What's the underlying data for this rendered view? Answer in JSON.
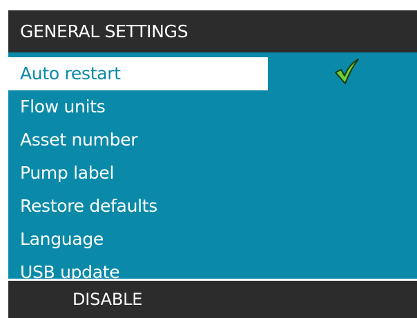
{
  "header": {
    "title": "GENERAL SETTINGS"
  },
  "menu": {
    "items": [
      {
        "label": "Auto restart",
        "selected": true,
        "checked": true
      },
      {
        "label": "Flow units"
      },
      {
        "label": "Asset number"
      },
      {
        "label": "Pump label"
      },
      {
        "label": "Restore defaults"
      },
      {
        "label": "Language"
      },
      {
        "label": "USB update"
      }
    ]
  },
  "footer": {
    "softkey_label": "DISABLE"
  },
  "colors": {
    "header_background": "#2c2c2c",
    "content_background": "#0a8aa8",
    "selected_background": "#ffffff",
    "selected_text": "#0a8aa8",
    "text": "#ffffff",
    "check_fill": "#6fd03a",
    "check_outline": "#1a3a10"
  },
  "icons": {
    "selected_item_status": "checkmark-icon"
  }
}
